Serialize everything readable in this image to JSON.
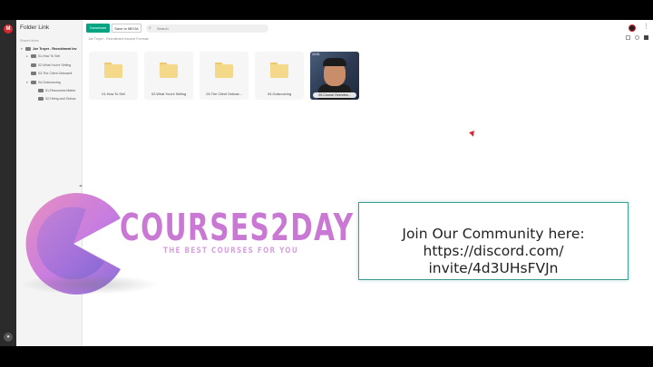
{
  "app": {
    "logo_letter": "M"
  },
  "sidebar": {
    "title": "Folder Link",
    "section_label": "Shared items",
    "items": [
      {
        "label": "Joe Troyer - Recruitment Inv",
        "level": 0
      },
      {
        "label": "01-How To Sell",
        "level": 1
      },
      {
        "label": "02-What You're Selling",
        "level": 1
      },
      {
        "label": "03-The Client Onboardi",
        "level": 1
      },
      {
        "label": "04-Outsourcing",
        "level": 1
      },
      {
        "label": "01-Resources Marke",
        "level": 2
      },
      {
        "label": "02-Hiring and Onboa",
        "level": 2
      }
    ]
  },
  "toolbar": {
    "download_label": "Download",
    "save_label": "Save to MEGA",
    "search_placeholder": "Search"
  },
  "breadcrumb": "Joe Troyer - Recruitment Income Formula",
  "tiles": [
    {
      "label": "01-How To Sell"
    },
    {
      "label": "02-What You're Selling"
    },
    {
      "label": "03-The Client Onboar..."
    },
    {
      "label": "04-Outsourcing"
    }
  ],
  "video_tile": {
    "label": "00-Course Overview...",
    "duration": "10:51"
  },
  "watermark": {
    "brand": "COURSES2DAY",
    "tagline": "THE BEST COURSES FOR YOU"
  },
  "community": {
    "line1": "Join Our Community here:",
    "line2": "https://discord.com/",
    "line3": "invite/4d3UHsFVJn"
  },
  "colors": {
    "accent_green": "#00a382",
    "mega_red": "#d9272e",
    "folder_yellow": "#f4d98a",
    "community_border": "#3e9e93",
    "brand_purple": "#c978d4"
  }
}
